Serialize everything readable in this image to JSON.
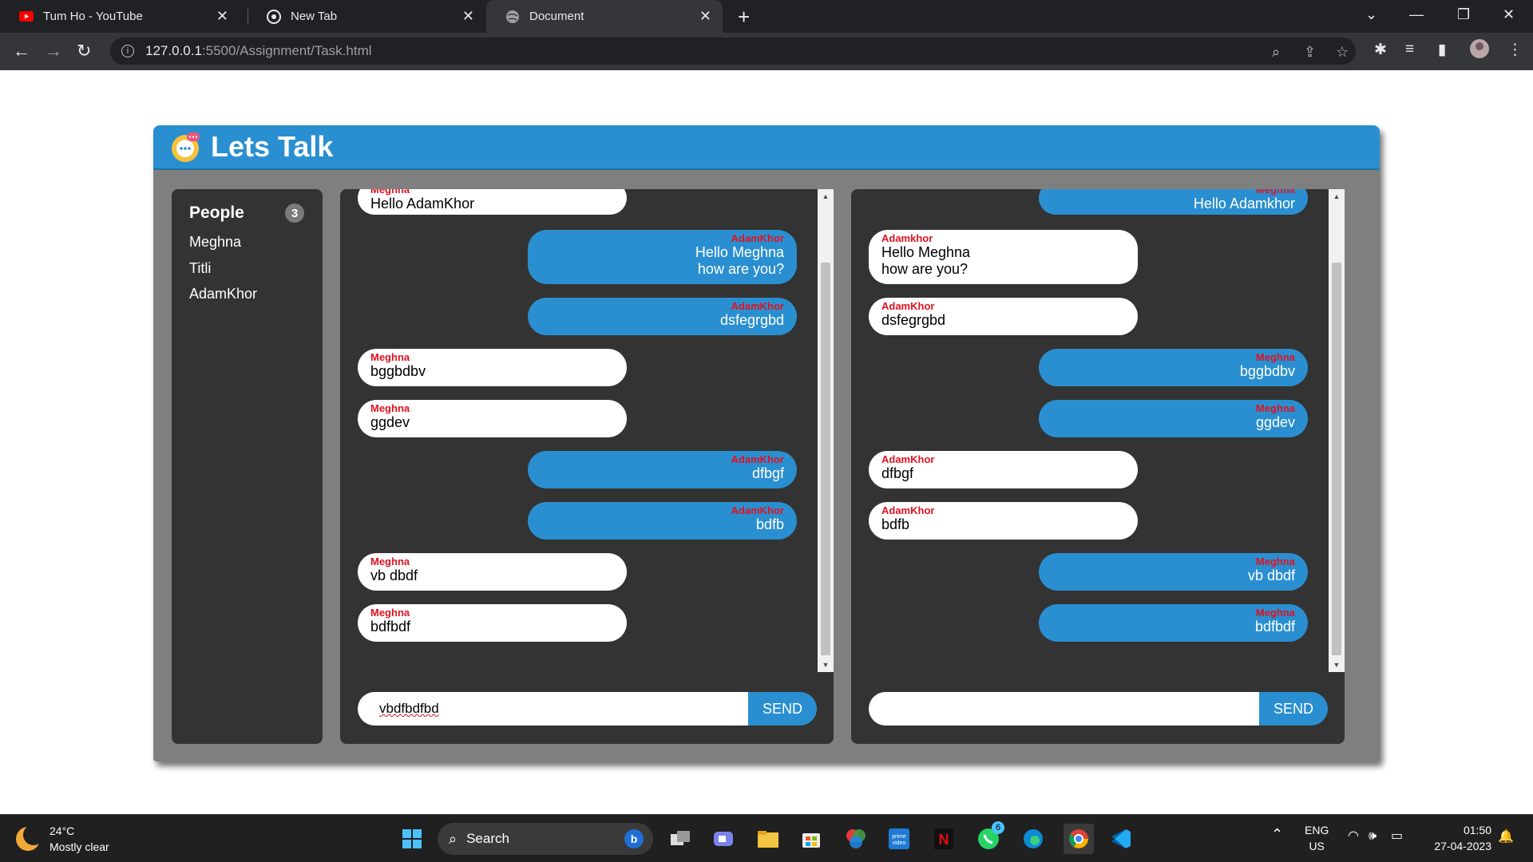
{
  "browser": {
    "tabs": [
      {
        "title": "Tum Ho - YouTube"
      },
      {
        "title": "New Tab"
      },
      {
        "title": "Document"
      }
    ],
    "url_host": "127.0.0.1",
    "url_path": ":5500/Assignment/Task.html"
  },
  "app": {
    "title": "Lets Talk",
    "people_heading": "People",
    "people_count": "3",
    "people": [
      "Meghna",
      "Titli",
      "AdamKhor"
    ],
    "send_label": "SEND"
  },
  "chat_a": {
    "input_value": "vbdfbdfbd",
    "messages": [
      {
        "sender": "Meghna",
        "text": "Hello AdamKhor"
      },
      {
        "sender": "AdamKhor",
        "text": "Hello Meghna\nhow are you?"
      },
      {
        "sender": "AdamKhor",
        "text": "dsfegrgbd"
      },
      {
        "sender": "Meghna",
        "text": "bggbdbv"
      },
      {
        "sender": "Meghna",
        "text": "ggdev"
      },
      {
        "sender": "AdamKhor",
        "text": "dfbgf"
      },
      {
        "sender": "AdamKhor",
        "text": "bdfb"
      },
      {
        "sender": "Meghna",
        "text": "vb dbdf"
      },
      {
        "sender": "Meghna",
        "text": "bdfbdf"
      }
    ]
  },
  "chat_b": {
    "input_value": "",
    "messages": [
      {
        "sender": "Meghna",
        "text": "Hello Adamkhor"
      },
      {
        "sender": "Adamkhor",
        "text": "Hello Meghna\nhow are you?"
      },
      {
        "sender": "AdamKhor",
        "text": "dsfegrgbd"
      },
      {
        "sender": "Meghna",
        "text": "bggbdbv"
      },
      {
        "sender": "Meghna",
        "text": "ggdev"
      },
      {
        "sender": "AdamKhor",
        "text": "dfbgf"
      },
      {
        "sender": "AdamKhor",
        "text": "bdfb"
      },
      {
        "sender": "Meghna",
        "text": "vb dbdf"
      },
      {
        "sender": "Meghna",
        "text": "bdfbdf"
      }
    ]
  },
  "taskbar": {
    "temperature": "24°C",
    "weather": "Mostly clear",
    "search_label": "Search",
    "whatsapp_badge": "6",
    "lang": "ENG",
    "region": "US",
    "time": "01:50",
    "date": "27-04-2023"
  },
  "colors": {
    "accent": "#2a8fd0",
    "sender_name": "#e0121f",
    "panel": "#333333",
    "app_frame": "#7f7f7f"
  }
}
